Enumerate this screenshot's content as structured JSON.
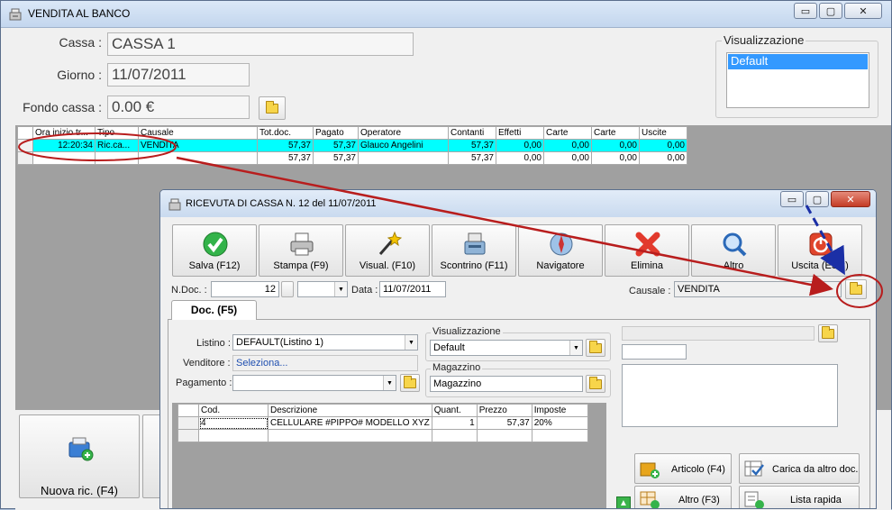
{
  "main_window": {
    "title": "VENDITA AL BANCO",
    "controls": {
      "minimize": "▭",
      "maximize": "▢",
      "close": "✕"
    }
  },
  "form": {
    "cassa_label": "Cassa :",
    "cassa_value": "CASSA 1",
    "giorno_label": "Giorno :",
    "giorno_value": "11/07/2011",
    "fondo_label": "Fondo cassa :",
    "fondo_value": "0.00 €"
  },
  "visualizzazione": {
    "title": "Visualizzazione",
    "selected": "Default"
  },
  "main_grid": {
    "headers": [
      "Ora inizio tr...",
      "Tipo",
      "Causale",
      "Tot.doc.",
      "Pagato",
      "Operatore",
      "Contanti",
      "Effetti",
      "Carte",
      "Carte",
      "Uscite"
    ],
    "rows": [
      [
        "12:20:34",
        "Ric.ca...",
        "VENDITA",
        "57,37",
        "57,37",
        "Glauco Angelini",
        "57,37",
        "0,00",
        "0,00",
        "0,00",
        "0,00"
      ],
      [
        "",
        "",
        "",
        "57,37",
        "57,37",
        "",
        "57,37",
        "0,00",
        "0,00",
        "0,00",
        "0,00"
      ]
    ]
  },
  "bottom": {
    "new_receipt_label": "Nuova ric. (F4)"
  },
  "receipt_window": {
    "title": "RICEVUTA DI CASSA N. 12  del 11/07/2011",
    "toolbar": [
      {
        "label": "Salva (F12)",
        "icon": "check-icon"
      },
      {
        "label": "Stampa (F9)",
        "icon": "printer-icon"
      },
      {
        "label": "Visual. (F10)",
        "icon": "magic-wand-icon"
      },
      {
        "label": "Scontrino (F11)",
        "icon": "cash-register-icon"
      },
      {
        "label": "Navigatore",
        "icon": "compass-icon"
      },
      {
        "label": "Elimina",
        "icon": "delete-icon"
      },
      {
        "label": "Altro",
        "icon": "search-icon"
      },
      {
        "label": "Uscita (ESC)",
        "icon": "power-icon"
      }
    ],
    "ndoc_label": "N.Doc. :",
    "ndoc_value": "12",
    "data_label": "Data :",
    "data_value": "11/07/2011",
    "causale_label": "Causale :",
    "causale_value": "VENDITA",
    "tab_label": "Doc. (F5)",
    "listino_label": "Listino :",
    "listino_value": "DEFAULT(Listino 1)",
    "venditore_label": "Venditore :",
    "venditore_value": "Seleziona...",
    "pagamento_label": "Pagamento :",
    "pagamento_value": "",
    "visual_title": "Visualizzazione",
    "visual_value": "Default",
    "magazzino_title": "Magazzino",
    "magazzino_value": "Magazzino",
    "detail_headers": [
      "Cod.",
      "Descrizione",
      "Quant.",
      "Prezzo",
      "Imposte"
    ],
    "detail_rows": [
      [
        "4",
        "CELLULARE #PIPPO# MODELLO XYZ",
        "1",
        "57,37",
        "20%"
      ]
    ],
    "buttons": {
      "articolo": "Articolo (F4)",
      "carica": "Carica da altro doc.",
      "altro": "Altro (F3)",
      "lista": "Lista rapida"
    }
  },
  "annotation_colors": {
    "arrow_red": "#b81d1d",
    "arrow_blue": "#1b2fa6",
    "highlight_row": "#00ffff"
  }
}
